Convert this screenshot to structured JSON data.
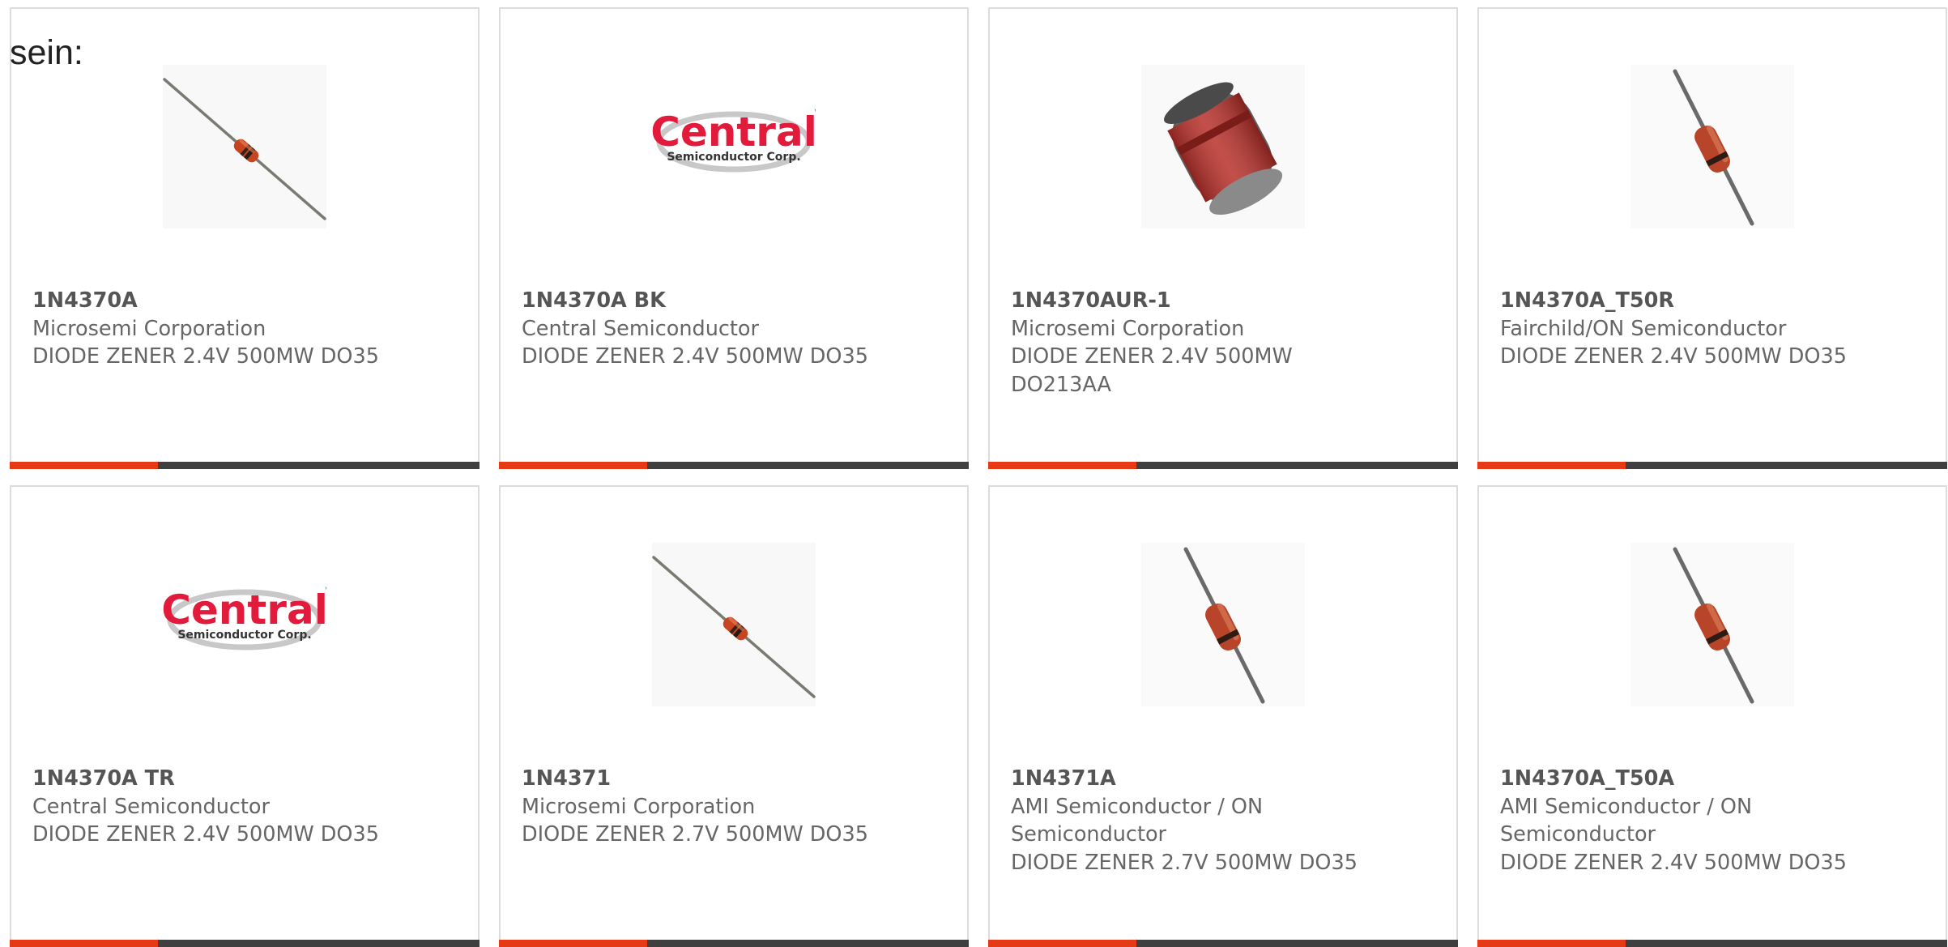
{
  "intro_text": "sein:",
  "colors": {
    "accent": "#e63a17",
    "bar": "#3f3f3f",
    "text": "#666666",
    "border": "#dcdcdc"
  },
  "products": [
    {
      "part_number": "1N4370A",
      "manufacturer": "Microsemi Corporation",
      "description": "DIODE ZENER 2.4V 500MW DO35",
      "image": "axial-diode-diagonal-image"
    },
    {
      "part_number": "1N4370A BK",
      "manufacturer": "Central Semiconductor",
      "description": "DIODE ZENER 2.4V 500MW DO35",
      "image": "central-semiconductor-logo"
    },
    {
      "part_number": "1N4370AUR-1",
      "manufacturer": "Microsemi Corporation",
      "description": "DIODE ZENER 2.4V 500MW DO213AA",
      "image": "melf-diode-image"
    },
    {
      "part_number": "1N4370A_T50R",
      "manufacturer": "Fairchild/ON Semiconductor",
      "description": "DIODE ZENER 2.4V 500MW DO35",
      "image": "axial-diode-steep-image"
    },
    {
      "part_number": "1N4370A TR",
      "manufacturer": "Central Semiconductor",
      "description": "DIODE ZENER 2.4V 500MW DO35",
      "image": "central-semiconductor-logo"
    },
    {
      "part_number": "1N4371",
      "manufacturer": "Microsemi Corporation",
      "description": "DIODE ZENER 2.7V 500MW DO35",
      "image": "axial-diode-diagonal-image"
    },
    {
      "part_number": "1N4371A",
      "manufacturer": "AMI Semiconductor / ON Semiconductor",
      "description": "DIODE ZENER 2.7V 500MW DO35",
      "image": "axial-diode-steep-image"
    },
    {
      "part_number": "1N4370A_T50A",
      "manufacturer": "AMI Semiconductor / ON Semiconductor",
      "description": "DIODE ZENER 2.4V 500MW DO35",
      "image": "axial-diode-steep-image"
    }
  ],
  "logo": {
    "brand": "Central",
    "tagline": "Semiconductor Corp.",
    "trademark": "™"
  }
}
